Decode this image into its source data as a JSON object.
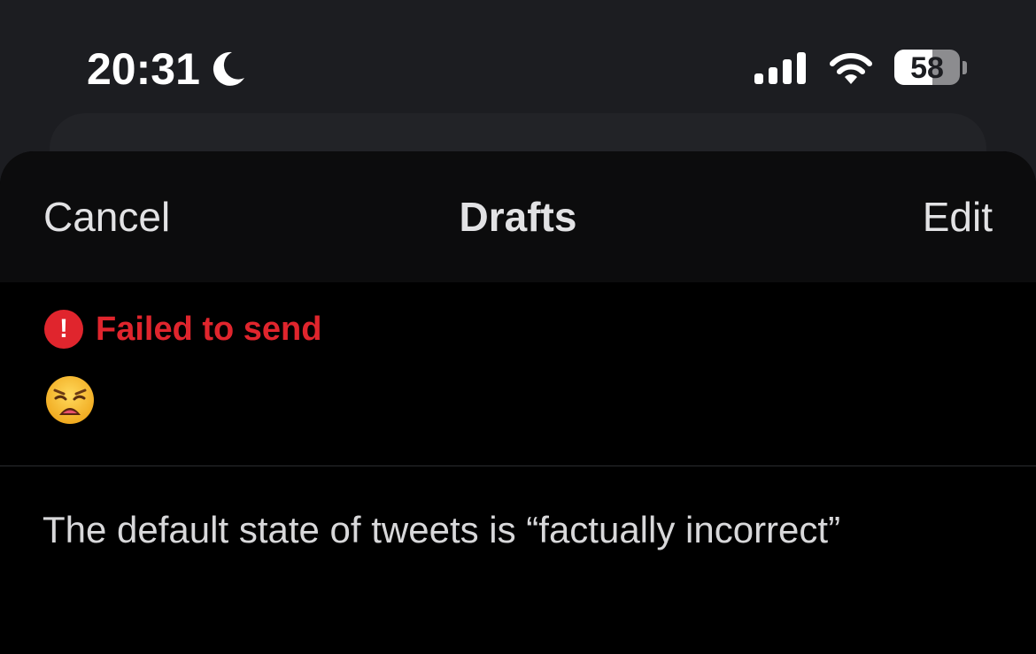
{
  "status_bar": {
    "time": "20:31",
    "focus_icon": "moon-icon",
    "signal_icon": "signal-icon",
    "wifi_icon": "wifi-icon",
    "battery_percent": "58",
    "battery_level": 0.58
  },
  "nav": {
    "cancel_label": "Cancel",
    "title": "Drafts",
    "edit_label": "Edit"
  },
  "drafts": [
    {
      "status_icon": "error-icon",
      "status_text": "Failed to send",
      "content_icon": "weary-face-emoji"
    },
    {
      "text": "The default state of tweets is “factually incorrect”"
    }
  ],
  "colors": {
    "background": "#1c1d21",
    "sheet": "#000000",
    "nav_bar": "#0c0c0d",
    "error": "#e0252d",
    "text": "#e2e2e4"
  }
}
